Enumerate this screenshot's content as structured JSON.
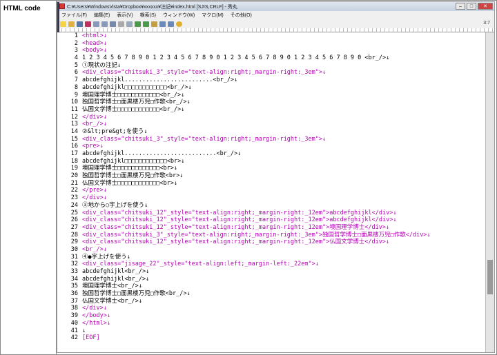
{
  "label": "HTML code",
  "window": {
    "title": "C:¥Users¥WindowsVista¥Dropbox¥xxxxxx¥注記¥index.html [SJIS,CRLF] - 秀丸",
    "position": "3:7"
  },
  "menu": [
    "ファイル(F)",
    "編集(E)",
    "表示(V)",
    "検索(S)",
    "ウィンドウ(W)",
    "マクロ(M)",
    "その他(O)"
  ],
  "lines": [
    {
      "n": "1",
      "t": "<html>↓",
      "c": "tag"
    },
    {
      "n": "2",
      "t": "<head>↓",
      "c": "tag"
    },
    {
      "n": "3",
      "t": "<body>↓",
      "c": "tag"
    },
    {
      "n": "4",
      "t": "1 2 3 4 5 6 7 8 9 0 1 2 3 4 5 6 7 8 9 0 1 2 3 4 5 6 7 8 9 0 1 2 3 4 5 6 7 8 9 0 <br_/>↓",
      "c": "plain"
    },
    {
      "n": "5",
      "t": "①現状の注記↓",
      "c": "plain"
    },
    {
      "n": "6",
      "t": "<div_class=\"chitsuki_3\"_style=\"text-align:right;_margin-right:_3em\">↓",
      "c": "tag"
    },
    {
      "n": "7",
      "t": "abcdefghijkl.........................<br_/>↓",
      "c": "plain"
    },
    {
      "n": "8",
      "t": "abcdefghijkl□□□□□□□□□□□□<br_/>↓",
      "c": "plain"
    },
    {
      "n": "9",
      "t": "墺国理学博士□□□□□□□□□□□□<br_/>↓",
      "c": "plain"
    },
    {
      "n": "10",
      "t": "独国哲学博士□面黒楼万児□作歌<br_/>↓",
      "c": "plain"
    },
    {
      "n": "11",
      "t": "仏国文学博士□□□□□□□□□□□□<br_/>↓",
      "c": "plain"
    },
    {
      "n": "12",
      "t": "</div>↓",
      "c": "tag"
    },
    {
      "n": "13",
      "t": "<br_/>↓",
      "c": "tag"
    },
    {
      "n": "14",
      "t": "②&lt;pre&gt;を使う↓",
      "c": "plain"
    },
    {
      "n": "15",
      "t": "<div_class=\"chitsuki_3\"_style=\"text-align:right;_margin-right:_3em\">↓",
      "c": "tag"
    },
    {
      "n": "16",
      "t": "<pre>↓",
      "c": "tag"
    },
    {
      "n": "17",
      "t": "abcdefghijkl..........................<br_/>↓",
      "c": "plain"
    },
    {
      "n": "18",
      "t": "abcdefghijkl□□□□□□□□□□□□<br>↓",
      "c": "plain"
    },
    {
      "n": "19",
      "t": "墺国理学博士□□□□□□□□□□□□<br>↓",
      "c": "plain"
    },
    {
      "n": "20",
      "t": "独国哲学博士□面黒楼万児□作歌<br>↓",
      "c": "plain"
    },
    {
      "n": "21",
      "t": "仏国文学博士□□□□□□□□□□□□<br>↓",
      "c": "plain"
    },
    {
      "n": "22",
      "t": "</pre>↓",
      "c": "tag"
    },
    {
      "n": "23",
      "t": "</div>↓",
      "c": "tag"
    },
    {
      "n": "24",
      "t": "③地から○字上げを使う↓",
      "c": "plain"
    },
    {
      "n": "25",
      "t": "<div_class=\"chitsuki_12\"_style=\"text-align:right;_margin-right:_12em\">abcdefghijkl</div>↓",
      "c": "tag"
    },
    {
      "n": "26",
      "t": "<div_class=\"chitsuki_12\"_style=\"text-align:right;_margin-right:_12em\">abcdefghijkl</div>↓",
      "c": "tag"
    },
    {
      "n": "27",
      "t": "<div_class=\"chitsuki_12\"_style=\"text-align:right;_margin-right:_12em\">墺国理学博士</div>↓",
      "c": "tag"
    },
    {
      "n": "28",
      "t": "<div_class=\"chitsuki_3\"_style=\"text-align:right;_margin-right:_3em\">独国哲学博士□面黒楼万児□作歌</div>↓",
      "c": "tag"
    },
    {
      "n": "29",
      "t": "<div_class=\"chitsuki_12\"_style=\"text-align:right;_margin-right:_12em\">仏国文学博士</div>↓",
      "c": "tag"
    },
    {
      "n": "30",
      "t": "<br_/>↓",
      "c": "tag"
    },
    {
      "n": "31",
      "t": "④●字上げを使う↓",
      "c": "plain"
    },
    {
      "n": "32",
      "t": "<div_class=\"jisage_22\"_style=\"text-align:left;_margin-left:_22em\">↓",
      "c": "tag"
    },
    {
      "n": "33",
      "t": "abcdefghijkl<br_/>↓",
      "c": "plain"
    },
    {
      "n": "34",
      "t": "abcdefghijkl<br_/>↓",
      "c": "plain"
    },
    {
      "n": "35",
      "t": "墺国理学博士<br_/>↓",
      "c": "plain"
    },
    {
      "n": "36",
      "t": "独国哲学博士□面黒楼万児□作歌<br_/>↓",
      "c": "plain"
    },
    {
      "n": "37",
      "t": "仏国文学博士<br_/>↓",
      "c": "plain"
    },
    {
      "n": "38",
      "t": "</div>↓",
      "c": "tag"
    },
    {
      "n": "39",
      "t": "</body>↓",
      "c": "tag"
    },
    {
      "n": "40",
      "t": "</html>↓",
      "c": "tag"
    },
    {
      "n": "41",
      "t": "↓",
      "c": "plain"
    },
    {
      "n": "42",
      "t": "[EOF]",
      "c": "tag"
    }
  ]
}
